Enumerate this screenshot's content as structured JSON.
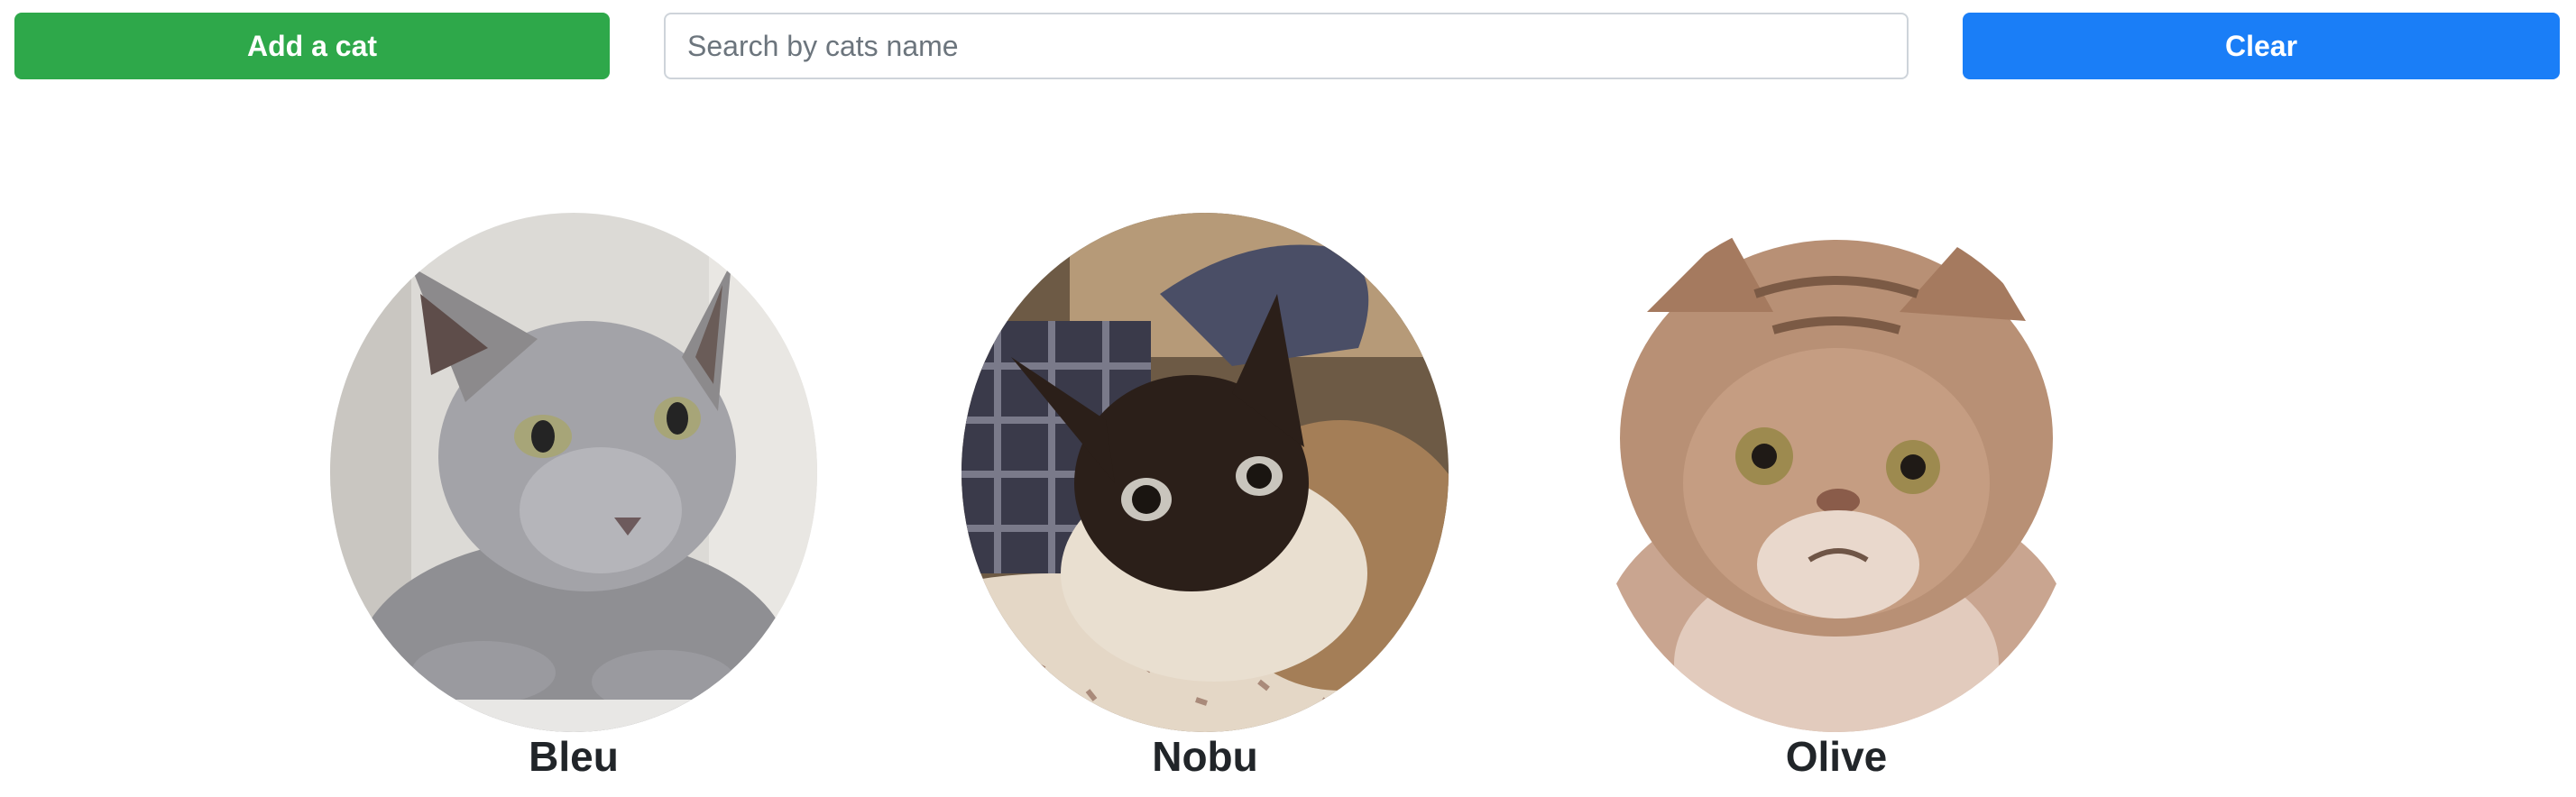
{
  "toolbar": {
    "add_label": "Add a cat",
    "search_placeholder": "Search by cats name",
    "search_value": "",
    "clear_label": "Clear"
  },
  "cats": [
    {
      "name": "Bleu",
      "photo_icon": "gray-cat-photo"
    },
    {
      "name": "Nobu",
      "photo_icon": "siamese-cat-photo"
    },
    {
      "name": "Olive",
      "photo_icon": "persian-cat-photo"
    }
  ],
  "colors": {
    "add_button": "#2ea84a",
    "clear_button": "#1a7ef7",
    "text": "#212529"
  }
}
